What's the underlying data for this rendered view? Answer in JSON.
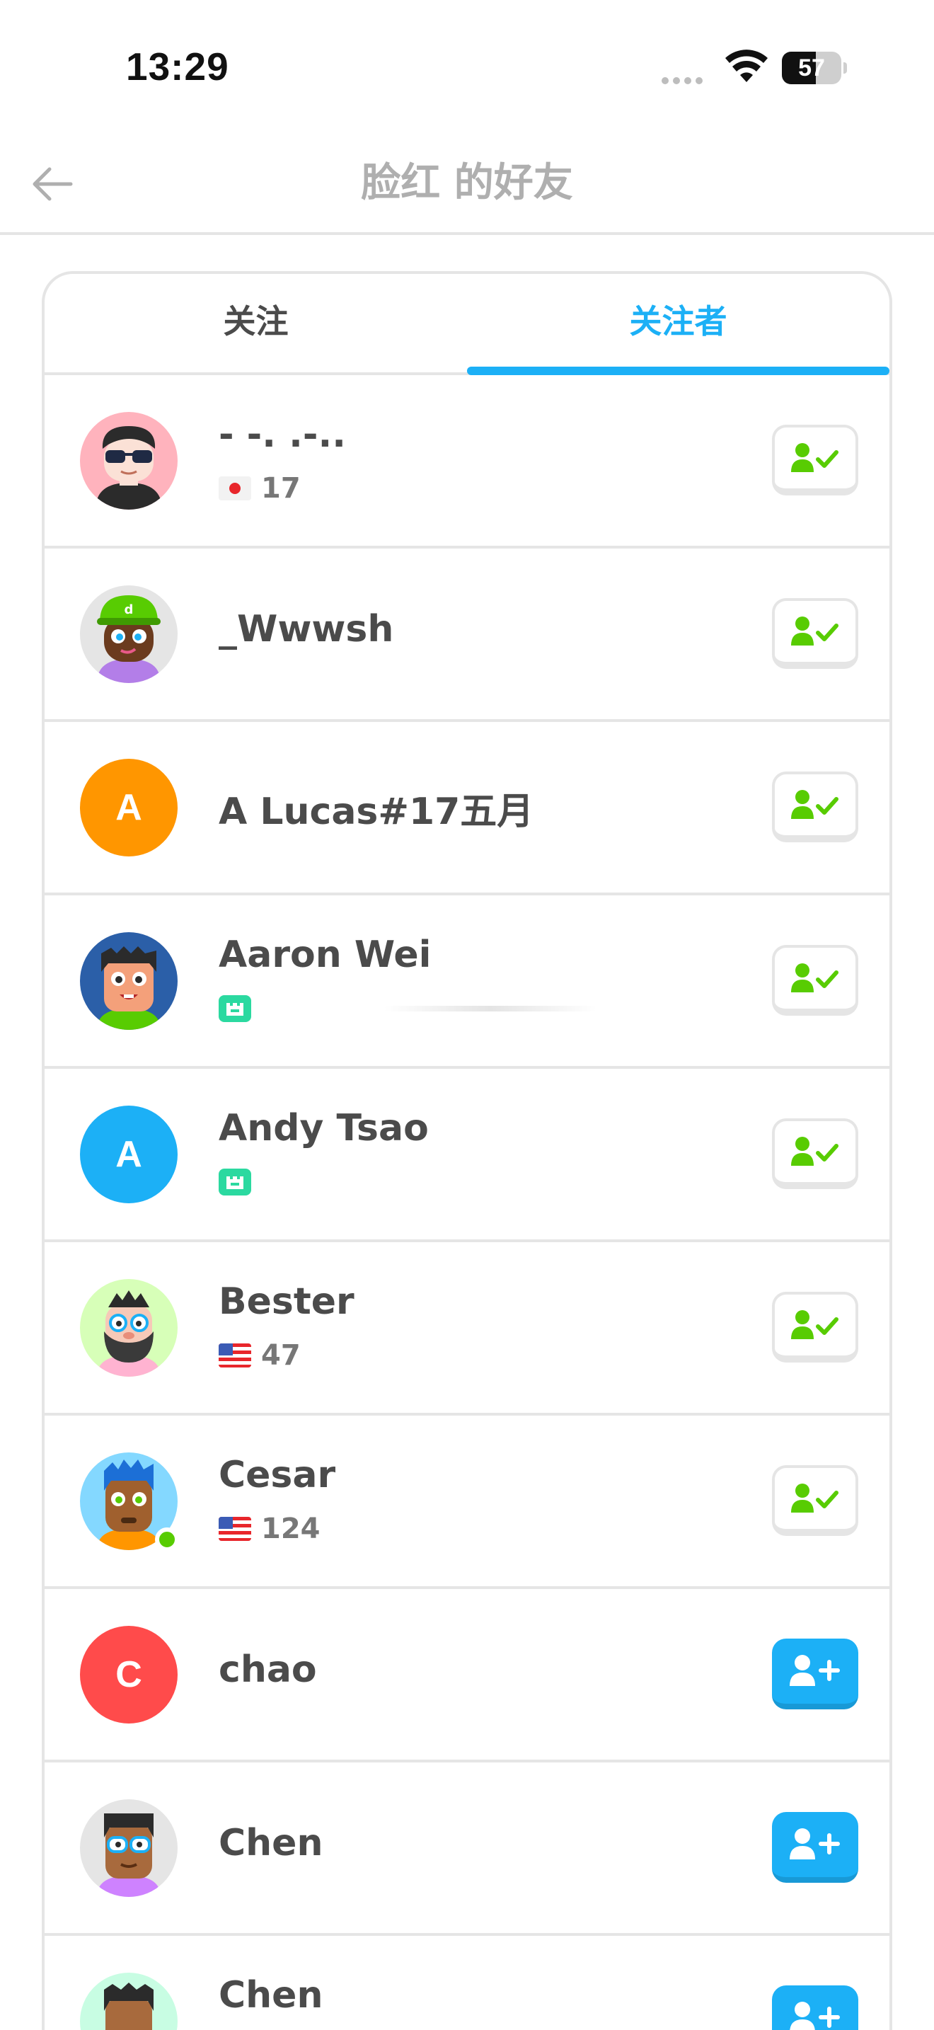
{
  "status_bar": {
    "time": "13:29",
    "battery_level": "57",
    "battery_fraction": 0.57
  },
  "header": {
    "title": "脸红 的好友",
    "back_icon": "arrow-left-icon"
  },
  "tabs": [
    {
      "label": "关注",
      "active": false
    },
    {
      "label": "关注者",
      "active": true
    }
  ],
  "colors": {
    "accent_blue": "#1cb0f6",
    "follow_green": "#58cc02",
    "text_dark": "#4b4b4b",
    "text_muted": "#afafaf",
    "divider": "#e5e5e5"
  },
  "users": [
    {
      "name": "- -. .-..",
      "country_flag": "japan-flag-icon",
      "stat": "17",
      "action": "following"
    },
    {
      "name": "_Wwwsh",
      "action": "following"
    },
    {
      "name": "A Lucas#17五月",
      "avatar_letter": "A",
      "avatar_color": "#ff9600",
      "action": "following"
    },
    {
      "name": "Aaron Wei",
      "badge": "castle-badge-icon",
      "action": "following"
    },
    {
      "name": "Andy Tsao",
      "avatar_letter": "A",
      "avatar_color": "#1cb0f6",
      "badge": "castle-badge-icon",
      "action": "following"
    },
    {
      "name": "Bester",
      "country_flag": "usa-flag-icon",
      "stat": "47",
      "action": "following"
    },
    {
      "name": "Cesar",
      "country_flag": "usa-flag-icon",
      "stat": "124",
      "online": true,
      "action": "following"
    },
    {
      "name": "chao",
      "avatar_letter": "C",
      "avatar_color": "#ff4b4b",
      "action": "add"
    },
    {
      "name": "Chen",
      "action": "add"
    },
    {
      "name": "Chen",
      "action": "add"
    }
  ]
}
